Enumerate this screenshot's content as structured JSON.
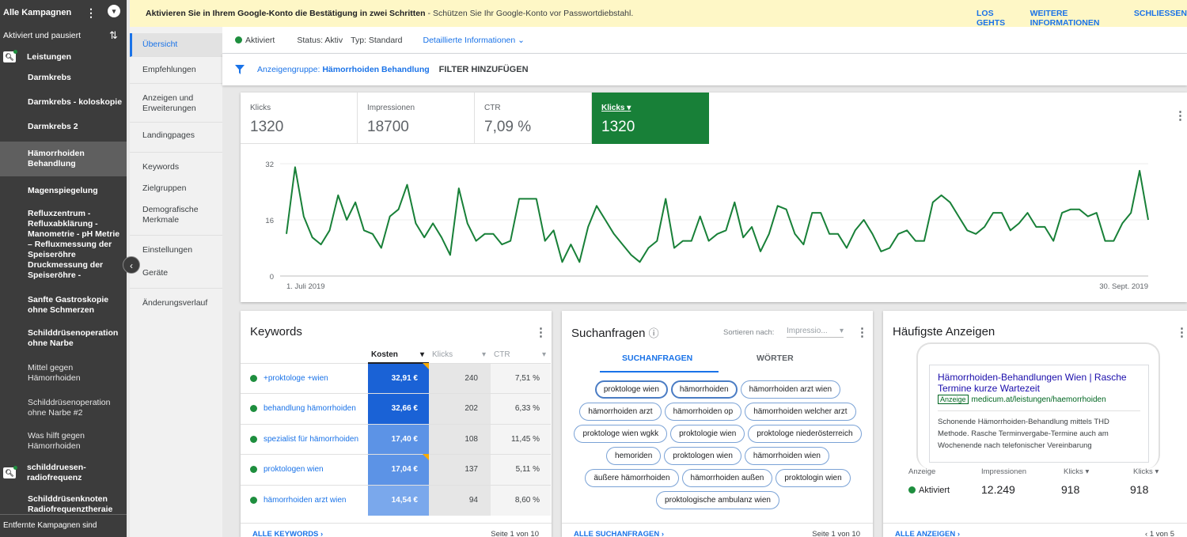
{
  "banner": {
    "bold": "Aktivieren Sie in Ihrem Google-Konto die Bestätigung in zwei Schritten",
    "rest": "- Schützen Sie Ihr Google-Konto vor Passwortdiebstahl.",
    "action1": "LOS GEHTS",
    "action2": "WEITERE INFORMATIONEN",
    "action3": "SCHLIESSEN"
  },
  "sidebar": {
    "top_title": "Alle Kampagnen",
    "filter": "Aktiviert und pausiert",
    "campaign1": "Leistungen",
    "items": [
      "Darmkrebs",
      "Darmkrebs - koloskopie",
      "Darmkrebs 2",
      "Hämorrhoiden Behandlung",
      "Magenspiegelung",
      "Refluxzentrum - Refluxabklärung - Manometrie - pH Metrie – Refluxmessung der Speiseröhre Druckmessung der Speiseröhre -",
      "Sanfte Gastroskopie ohne Schmerzen",
      "Schilddrüsenoperation ohne Narbe",
      "Mittel gegen Hämorrhoiden",
      "Schilddrüsenoperation ohne Narbe #2",
      "Was hilft gegen Hämorrhoiden"
    ],
    "campaign2": "schilddruesen-radiofrequenz",
    "item_after": "Schilddrüsenknoten Radiofrequenztheraie",
    "footer": "Entfernte Kampagnen sind"
  },
  "nav2": [
    "Übersicht",
    "Empfehlungen",
    "Anzeigen und Erweiterungen",
    "Landingpages",
    "Keywords",
    "Zielgruppen",
    "Demografische Merkmale",
    "Einstellungen",
    "Geräte",
    "Änderungsverlauf"
  ],
  "status": {
    "state": "Aktiviert",
    "status": "Status: Aktiv",
    "type": "Typ: Standard",
    "details": "Detaillierte Informationen"
  },
  "filter": {
    "label": "Anzeigengruppe:",
    "value": "Hämorrhoiden Behandlung",
    "add": "FILTER HINZUFÜGEN"
  },
  "metrics": [
    {
      "label": "Klicks",
      "value": "1320"
    },
    {
      "label": "Impressionen",
      "value": "18700"
    },
    {
      "label": "CTR",
      "value": "7,09 %"
    },
    {
      "label": "Klicks",
      "value": "1320"
    }
  ],
  "chart_data": {
    "type": "line",
    "x_start": "1. Juli 2019",
    "x_end": "30. Sept. 2019",
    "ylim": [
      0,
      32
    ],
    "yticks": [
      "32",
      "16",
      "0"
    ],
    "color": "#188038",
    "series": [
      {
        "values": [
          12,
          31,
          17,
          11,
          9,
          13,
          23,
          16,
          21,
          13,
          12,
          8,
          17,
          19,
          26,
          15,
          11,
          15,
          11,
          6,
          25,
          15,
          10,
          12,
          12,
          9,
          10,
          22,
          22,
          22,
          10,
          13,
          4,
          9,
          4,
          14,
          20,
          16,
          12,
          9,
          6,
          4,
          8,
          10,
          22,
          8,
          10,
          10,
          17,
          10,
          12,
          13,
          21,
          11,
          14,
          7,
          12,
          20,
          19,
          12,
          9,
          18,
          18,
          12,
          12,
          8,
          13,
          16,
          12,
          7,
          8,
          12,
          13,
          10,
          10,
          21,
          23,
          21,
          17,
          13,
          12,
          14,
          18,
          18,
          13,
          15,
          18,
          14,
          14,
          10,
          18,
          19,
          19,
          17,
          18,
          10,
          10,
          15,
          18,
          30,
          16
        ]
      }
    ]
  },
  "keywords": {
    "title": "Keywords",
    "col_cost": "Kosten",
    "col_clicks": "Klicks",
    "col_ctr": "CTR",
    "rows": [
      {
        "kw": "+proktologe +wien",
        "cost": "32,91 €",
        "clicks": "240",
        "ctr": "7,51 %",
        "color": "#1a62d6"
      },
      {
        "kw": "behandlung hämorrhoiden",
        "cost": "32,66 €",
        "clicks": "202",
        "ctr": "6,33 %",
        "color": "#1a62d6"
      },
      {
        "kw": "spezialist für hämorrhoiden",
        "cost": "17,40 €",
        "clicks": "108",
        "ctr": "11,45 %",
        "color": "#5c93e6"
      },
      {
        "kw": "proktologen wien",
        "cost": "17,04 €",
        "clicks": "137",
        "ctr": "5,11 %",
        "color": "#5c93e6"
      },
      {
        "kw": "hämorrhoiden arzt wien",
        "cost": "14,54 €",
        "clicks": "94",
        "ctr": "8,60 %",
        "color": "#7aa8ec"
      }
    ],
    "footer_link": "ALLE KEYWORDS",
    "footer_page": "Seite 1 von 10"
  },
  "queries": {
    "title": "Suchanfragen",
    "sort_label": "Sortieren nach:",
    "sort_value": "Impressio...",
    "tab1": "SUCHANFRAGEN",
    "tab2": "WÖRTER",
    "chips": [
      "proktologe wien",
      "hämorrhoiden",
      "hämorrhoiden arzt wien",
      "hämorrhoiden arzt",
      "hämorrhoiden op",
      "hämorrhoiden welcher arzt",
      "proktologe wien wgkk",
      "proktologie wien",
      "proktologe niederösterreich",
      "hemoriden",
      "proktologen wien",
      "hämorrhoiden wien",
      "äußere hämorrhoiden",
      "hämorrhoiden außen",
      "proktologin wien",
      "proktologische ambulanz wien"
    ],
    "footer_link": "ALLE SUCHANFRAGEN",
    "footer_page": "Seite 1 von 10"
  },
  "ads": {
    "title": "Häufigste Anzeigen",
    "ad_title": "Hämorrhoiden-Behandlungen Wien | Rasche Termine kurze Wartezeit",
    "badge": "Anzeige",
    "url": "medicum.at/leistungen/haemorrhoiden",
    "desc": "Schonende Hämorrhoiden-Behandlung mittels THD Methode. Rasche Terminvergabe-Termine auch am Wochenende nach telefonischer Vereinbarung",
    "h_ad": "Anzeige",
    "h_imp": "Impressionen",
    "h_clicks1": "Klicks",
    "h_clicks2": "Klicks",
    "v_state": "Aktiviert",
    "v_imp": "12.249",
    "v_clicks1": "918",
    "v_clicks2": "918",
    "footer_link": "ALLE ANZEIGEN",
    "footer_page": "1 von 5"
  }
}
